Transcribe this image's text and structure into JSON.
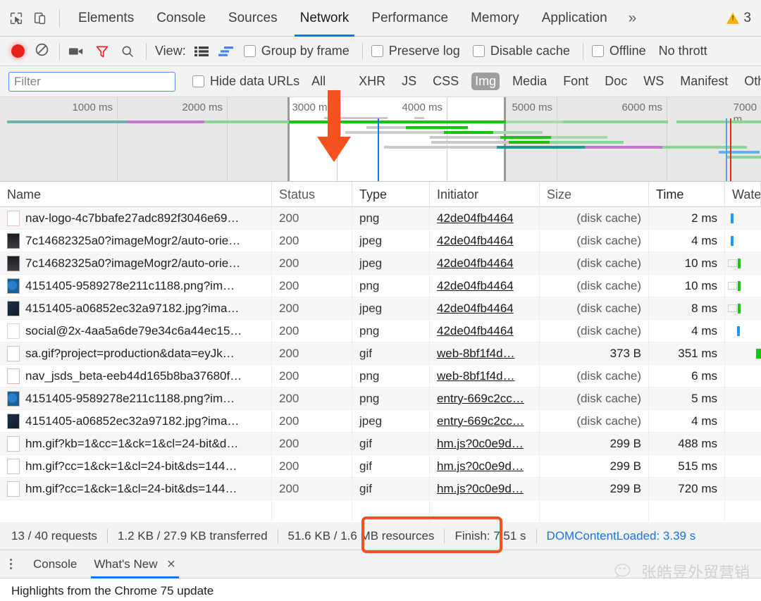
{
  "devtools": {
    "main_tabs": [
      {
        "label": "Elements",
        "active": false
      },
      {
        "label": "Console",
        "active": false
      },
      {
        "label": "Sources",
        "active": false
      },
      {
        "label": "Network",
        "active": true
      },
      {
        "label": "Performance",
        "active": false
      },
      {
        "label": "Memory",
        "active": false
      },
      {
        "label": "Application",
        "active": false
      }
    ],
    "more_tabs_icon": "»",
    "warning_count": "3",
    "inspect_icon": "inspect-element-icon",
    "device_icon": "device-toolbar-icon"
  },
  "toolbar": {
    "record_label": "record-button",
    "clear_label": "clear-button",
    "camera_label": "capture-screenshots-button",
    "filter_label": "filter-button",
    "search_label": "search-button",
    "view_label": "View:",
    "view_list_icon": "list-view-icon",
    "view_waterfall_icon": "waterfall-view-icon",
    "group_by_frame": "Group by frame",
    "preserve_log": "Preserve log",
    "disable_cache": "Disable cache",
    "offline": "Offline",
    "throttling": "No thrott"
  },
  "filterbar": {
    "filter_placeholder": "Filter",
    "hide_data_urls": "Hide data URLs",
    "types": [
      {
        "label": "All",
        "selected": false
      },
      {
        "label": "XHR",
        "selected": false
      },
      {
        "label": "JS",
        "selected": false
      },
      {
        "label": "CSS",
        "selected": false
      },
      {
        "label": "Img",
        "selected": true
      },
      {
        "label": "Media",
        "selected": false
      },
      {
        "label": "Font",
        "selected": false
      },
      {
        "label": "Doc",
        "selected": false
      },
      {
        "label": "WS",
        "selected": false
      },
      {
        "label": "Manifest",
        "selected": false
      },
      {
        "label": "Other",
        "selected": false
      }
    ]
  },
  "overview": {
    "ticks": [
      "1000 ms",
      "2000 ms",
      "3000 ms",
      "4000 ms",
      "5000 ms",
      "6000 ms",
      "7000 m"
    ],
    "selection_start_ms": 2900,
    "selection_end_ms": 4900,
    "domcontentloaded_ms": 3390,
    "load_ms": 7000
  },
  "table": {
    "columns": [
      "Name",
      "Status",
      "Type",
      "Initiator",
      "Size",
      "Time",
      "Water"
    ],
    "rows": [
      {
        "name": "nav-logo-4c7bbafe27adc892f3046e69…",
        "status": "200",
        "type": "png",
        "initiator": "42de04fb4464",
        "size": "(disk cache)",
        "time": "2 ms",
        "wf": "bar-blue"
      },
      {
        "name": "7c14682325a0?imageMogr2/auto-orie…",
        "status": "200",
        "type": "jpeg",
        "initiator": "42de04fb4464",
        "size": "(disk cache)",
        "time": "4 ms",
        "wf": "bar-blue"
      },
      {
        "name": "7c14682325a0?imageMogr2/auto-orie…",
        "status": "200",
        "type": "jpeg",
        "initiator": "42de04fb4464",
        "size": "(disk cache)",
        "time": "10 ms",
        "wf": "bar-wait-green"
      },
      {
        "name": "4151405-9589278e211c1188.png?im…",
        "status": "200",
        "type": "png",
        "initiator": "42de04fb4464",
        "size": "(disk cache)",
        "time": "10 ms",
        "wf": "bar-wait-green"
      },
      {
        "name": "4151405-a06852ec32a97182.jpg?ima…",
        "status": "200",
        "type": "jpeg",
        "initiator": "42de04fb4464",
        "size": "(disk cache)",
        "time": "8 ms",
        "wf": "bar-wait-green"
      },
      {
        "name": "social@2x-4aa5a6de79e34c6a44ec15…",
        "status": "200",
        "type": "png",
        "initiator": "42de04fb4464",
        "size": "(disk cache)",
        "time": "4 ms",
        "wf": "bar-blue"
      },
      {
        "name": "sa.gif?project=production&data=eyJk…",
        "status": "200",
        "type": "gif",
        "initiator": "web-8bf1f4d…",
        "size": "373 B",
        "time": "351 ms",
        "wf": "bar-green-right"
      },
      {
        "name": "nav_jsds_beta-eeb44d165b8ba37680f…",
        "status": "200",
        "type": "png",
        "initiator": "web-8bf1f4d…",
        "size": "(disk cache)",
        "time": "6 ms",
        "wf": "none"
      },
      {
        "name": "4151405-9589278e211c1188.png?im…",
        "status": "200",
        "type": "png",
        "initiator": "entry-669c2cc…",
        "size": "(disk cache)",
        "time": "5 ms",
        "wf": "none"
      },
      {
        "name": "4151405-a06852ec32a97182.jpg?ima…",
        "status": "200",
        "type": "jpeg",
        "initiator": "entry-669c2cc…",
        "size": "(disk cache)",
        "time": "4 ms",
        "wf": "none"
      },
      {
        "name": "hm.gif?kb=1&cc=1&ck=1&cl=24-bit&d…",
        "status": "200",
        "type": "gif",
        "initiator": "hm.js?0c0e9d…",
        "size": "299 B",
        "time": "488 ms",
        "wf": "none"
      },
      {
        "name": "hm.gif?cc=1&ck=1&cl=24-bit&ds=144…",
        "status": "200",
        "type": "gif",
        "initiator": "hm.js?0c0e9d…",
        "size": "299 B",
        "time": "515 ms",
        "wf": "none"
      },
      {
        "name": "hm.gif?cc=1&ck=1&cl=24-bit&ds=144…",
        "status": "200",
        "type": "gif",
        "initiator": "hm.js?0c0e9d…",
        "size": "299 B",
        "time": "720 ms",
        "wf": "none"
      }
    ]
  },
  "statusbar": {
    "requests": "13 / 40 requests",
    "transferred": "1.2 KB / 27.9 KB transferred",
    "resources": "51.6 KB / 1.6 MB resources",
    "finish": "Finish: 7.51 s",
    "dcl": "DOMContentLoaded: 3.39 s"
  },
  "drawer": {
    "tabs": [
      {
        "label": "Console",
        "active": false,
        "closable": false
      },
      {
        "label": "What's New",
        "active": true,
        "closable": true
      }
    ],
    "close_glyph": "✕",
    "body_text": "Highlights from the Chrome 75 update"
  },
  "watermark": {
    "text": "张皓昱外贸营销"
  },
  "annotations": {
    "arrow_color": "#f4511e",
    "highlight_color": "#f4511e",
    "highlight_target": "51.6 KB / 1.6 MB resources"
  }
}
